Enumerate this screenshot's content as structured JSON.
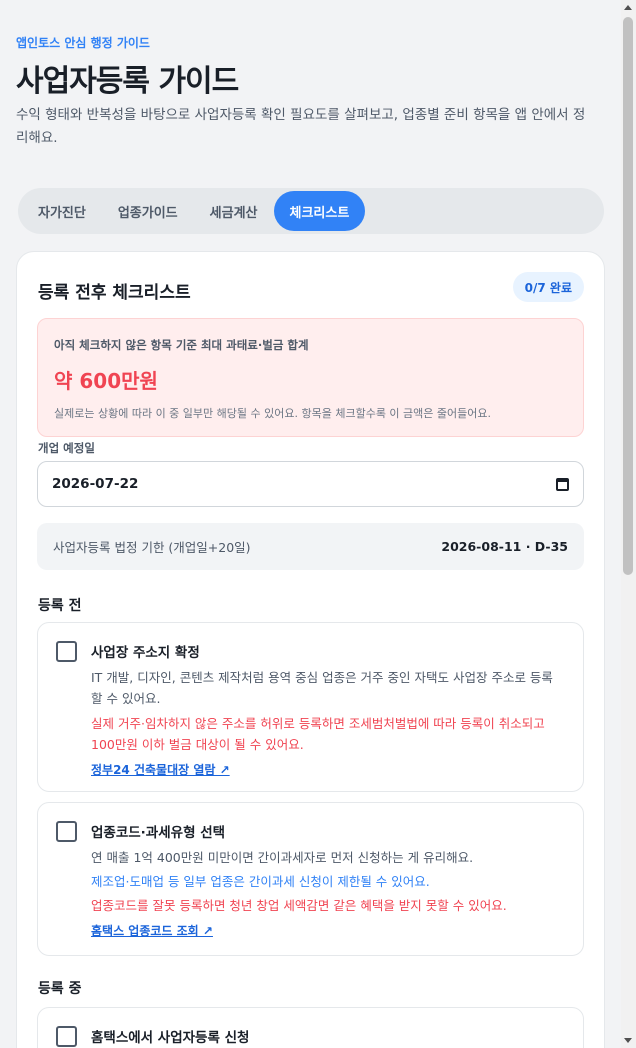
{
  "header": {
    "eyebrow": "앱인토스 안심 행정 가이드",
    "title": "사업자등록 가이드",
    "description": "수익 형태와 반복성을 바탕으로 사업자등록 확인 필요도를 살펴보고, 업종별 준비 항목을 앱 안에서 정리해요."
  },
  "tabs": [
    {
      "label": "자가진단",
      "active": false
    },
    {
      "label": "업종가이드",
      "active": false
    },
    {
      "label": "세금계산",
      "active": false
    },
    {
      "label": "체크리스트",
      "active": true
    }
  ],
  "card": {
    "title": "등록 전후 체크리스트",
    "progress": "0/7 완료",
    "alert": {
      "label": "아직 체크하지 않은 항목 기준 최대 과태료·벌금 합계",
      "amount": "약 600만원",
      "note": "실제로는 상황에 따라 이 중 일부만 해당될 수 있어요. 항목을 체크할수록 이 금액은 줄어들어요."
    },
    "date_field": {
      "label": "개업 예정일",
      "value": "2026-07-22"
    },
    "deadline": {
      "label": "사업자등록 법정 기한 (개업일+20일)",
      "value": "2026-08-11 · D-35"
    },
    "sections": [
      {
        "title": "등록 전",
        "items": [
          {
            "title": "사업장 주소지 확정",
            "desc": "IT 개발, 디자인, 콘텐츠 제작처럼 용역 중심 업종은 거주 중인 자택도 사업장 주소로 등록할 수 있어요.",
            "warning": "실제 거주·임차하지 않은 주소를 허위로 등록하면 조세범처벌법에 따라 등록이 취소되고 100만원 이하 벌금 대상이 될 수 있어요.",
            "link": "정부24 건축물대장 열람 ↗",
            "checked": false
          },
          {
            "title": "업종코드·과세유형 선택",
            "desc": "연 매출 1억 400만원 미만이면 간이과세자로 먼저 신청하는 게 유리해요.",
            "info": "제조업·도매업 등 일부 업종은 간이과세 신청이 제한될 수 있어요.",
            "warning": "업종코드를 잘못 등록하면 청년 창업 세액감면 같은 혜택을 받지 못할 수 있어요.",
            "link": "홈택스 업종코드 조회 ↗",
            "checked": false
          }
        ]
      },
      {
        "title": "등록 중",
        "items": [
          {
            "title": "홈택스에서 사업자등록 신청",
            "checked": false
          }
        ]
      }
    ]
  }
}
